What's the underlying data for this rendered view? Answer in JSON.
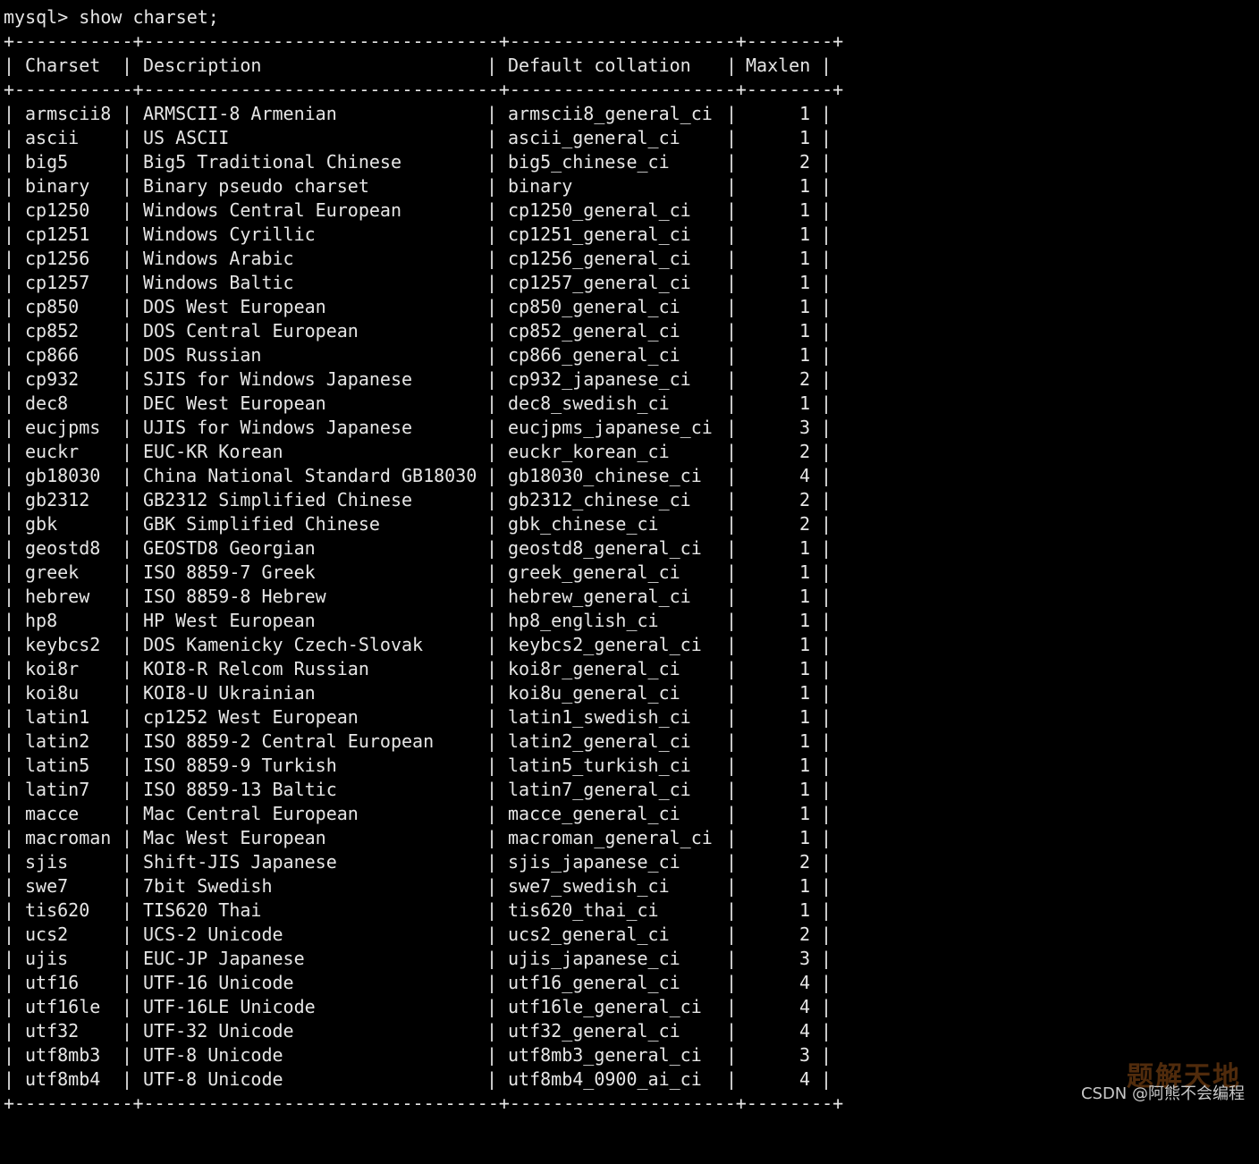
{
  "terminal": {
    "prompt": "mysql> show charset;",
    "border": "+-----------+---------------------------------+---------------------+--------+",
    "headers": {
      "charset": "Charset",
      "description": "Description",
      "default_collation": "Default collation",
      "maxlen": "Maxlen"
    },
    "rows": [
      {
        "charset": "armscii8",
        "description": "ARMSCII-8 Armenian",
        "collation": "armscii8_general_ci",
        "maxlen": "1"
      },
      {
        "charset": "ascii",
        "description": "US ASCII",
        "collation": "ascii_general_ci",
        "maxlen": "1"
      },
      {
        "charset": "big5",
        "description": "Big5 Traditional Chinese",
        "collation": "big5_chinese_ci",
        "maxlen": "2"
      },
      {
        "charset": "binary",
        "description": "Binary pseudo charset",
        "collation": "binary",
        "maxlen": "1"
      },
      {
        "charset": "cp1250",
        "description": "Windows Central European",
        "collation": "cp1250_general_ci",
        "maxlen": "1"
      },
      {
        "charset": "cp1251",
        "description": "Windows Cyrillic",
        "collation": "cp1251_general_ci",
        "maxlen": "1"
      },
      {
        "charset": "cp1256",
        "description": "Windows Arabic",
        "collation": "cp1256_general_ci",
        "maxlen": "1"
      },
      {
        "charset": "cp1257",
        "description": "Windows Baltic",
        "collation": "cp1257_general_ci",
        "maxlen": "1"
      },
      {
        "charset": "cp850",
        "description": "DOS West European",
        "collation": "cp850_general_ci",
        "maxlen": "1"
      },
      {
        "charset": "cp852",
        "description": "DOS Central European",
        "collation": "cp852_general_ci",
        "maxlen": "1"
      },
      {
        "charset": "cp866",
        "description": "DOS Russian",
        "collation": "cp866_general_ci",
        "maxlen": "1"
      },
      {
        "charset": "cp932",
        "description": "SJIS for Windows Japanese",
        "collation": "cp932_japanese_ci",
        "maxlen": "2"
      },
      {
        "charset": "dec8",
        "description": "DEC West European",
        "collation": "dec8_swedish_ci",
        "maxlen": "1"
      },
      {
        "charset": "eucjpms",
        "description": "UJIS for Windows Japanese",
        "collation": "eucjpms_japanese_ci",
        "maxlen": "3"
      },
      {
        "charset": "euckr",
        "description": "EUC-KR Korean",
        "collation": "euckr_korean_ci",
        "maxlen": "2"
      },
      {
        "charset": "gb18030",
        "description": "China National Standard GB18030",
        "collation": "gb18030_chinese_ci",
        "maxlen": "4"
      },
      {
        "charset": "gb2312",
        "description": "GB2312 Simplified Chinese",
        "collation": "gb2312_chinese_ci",
        "maxlen": "2"
      },
      {
        "charset": "gbk",
        "description": "GBK Simplified Chinese",
        "collation": "gbk_chinese_ci",
        "maxlen": "2"
      },
      {
        "charset": "geostd8",
        "description": "GEOSTD8 Georgian",
        "collation": "geostd8_general_ci",
        "maxlen": "1"
      },
      {
        "charset": "greek",
        "description": "ISO 8859-7 Greek",
        "collation": "greek_general_ci",
        "maxlen": "1"
      },
      {
        "charset": "hebrew",
        "description": "ISO 8859-8 Hebrew",
        "collation": "hebrew_general_ci",
        "maxlen": "1"
      },
      {
        "charset": "hp8",
        "description": "HP West European",
        "collation": "hp8_english_ci",
        "maxlen": "1"
      },
      {
        "charset": "keybcs2",
        "description": "DOS Kamenicky Czech-Slovak",
        "collation": "keybcs2_general_ci",
        "maxlen": "1"
      },
      {
        "charset": "koi8r",
        "description": "KOI8-R Relcom Russian",
        "collation": "koi8r_general_ci",
        "maxlen": "1"
      },
      {
        "charset": "koi8u",
        "description": "KOI8-U Ukrainian",
        "collation": "koi8u_general_ci",
        "maxlen": "1"
      },
      {
        "charset": "latin1",
        "description": "cp1252 West European",
        "collation": "latin1_swedish_ci",
        "maxlen": "1"
      },
      {
        "charset": "latin2",
        "description": "ISO 8859-2 Central European",
        "collation": "latin2_general_ci",
        "maxlen": "1"
      },
      {
        "charset": "latin5",
        "description": "ISO 8859-9 Turkish",
        "collation": "latin5_turkish_ci",
        "maxlen": "1"
      },
      {
        "charset": "latin7",
        "description": "ISO 8859-13 Baltic",
        "collation": "latin7_general_ci",
        "maxlen": "1"
      },
      {
        "charset": "macce",
        "description": "Mac Central European",
        "collation": "macce_general_ci",
        "maxlen": "1"
      },
      {
        "charset": "macroman",
        "description": "Mac West European",
        "collation": "macroman_general_ci",
        "maxlen": "1"
      },
      {
        "charset": "sjis",
        "description": "Shift-JIS Japanese",
        "collation": "sjis_japanese_ci",
        "maxlen": "2"
      },
      {
        "charset": "swe7",
        "description": "7bit Swedish",
        "collation": "swe7_swedish_ci",
        "maxlen": "1"
      },
      {
        "charset": "tis620",
        "description": "TIS620 Thai",
        "collation": "tis620_thai_ci",
        "maxlen": "1"
      },
      {
        "charset": "ucs2",
        "description": "UCS-2 Unicode",
        "collation": "ucs2_general_ci",
        "maxlen": "2"
      },
      {
        "charset": "ujis",
        "description": "EUC-JP Japanese",
        "collation": "ujis_japanese_ci",
        "maxlen": "3"
      },
      {
        "charset": "utf16",
        "description": "UTF-16 Unicode",
        "collation": "utf16_general_ci",
        "maxlen": "4"
      },
      {
        "charset": "utf16le",
        "description": "UTF-16LE Unicode",
        "collation": "utf16le_general_ci",
        "maxlen": "4"
      },
      {
        "charset": "utf32",
        "description": "UTF-32 Unicode",
        "collation": "utf32_general_ci",
        "maxlen": "4"
      },
      {
        "charset": "utf8mb3",
        "description": "UTF-8 Unicode",
        "collation": "utf8mb3_general_ci",
        "maxlen": "3"
      },
      {
        "charset": "utf8mb4",
        "description": "UTF-8 Unicode",
        "collation": "utf8mb4_0900_ai_ci",
        "maxlen": "4"
      }
    ]
  },
  "watermark": {
    "text": "CSDN @阿熊不会编程",
    "logo": "题解天地"
  }
}
